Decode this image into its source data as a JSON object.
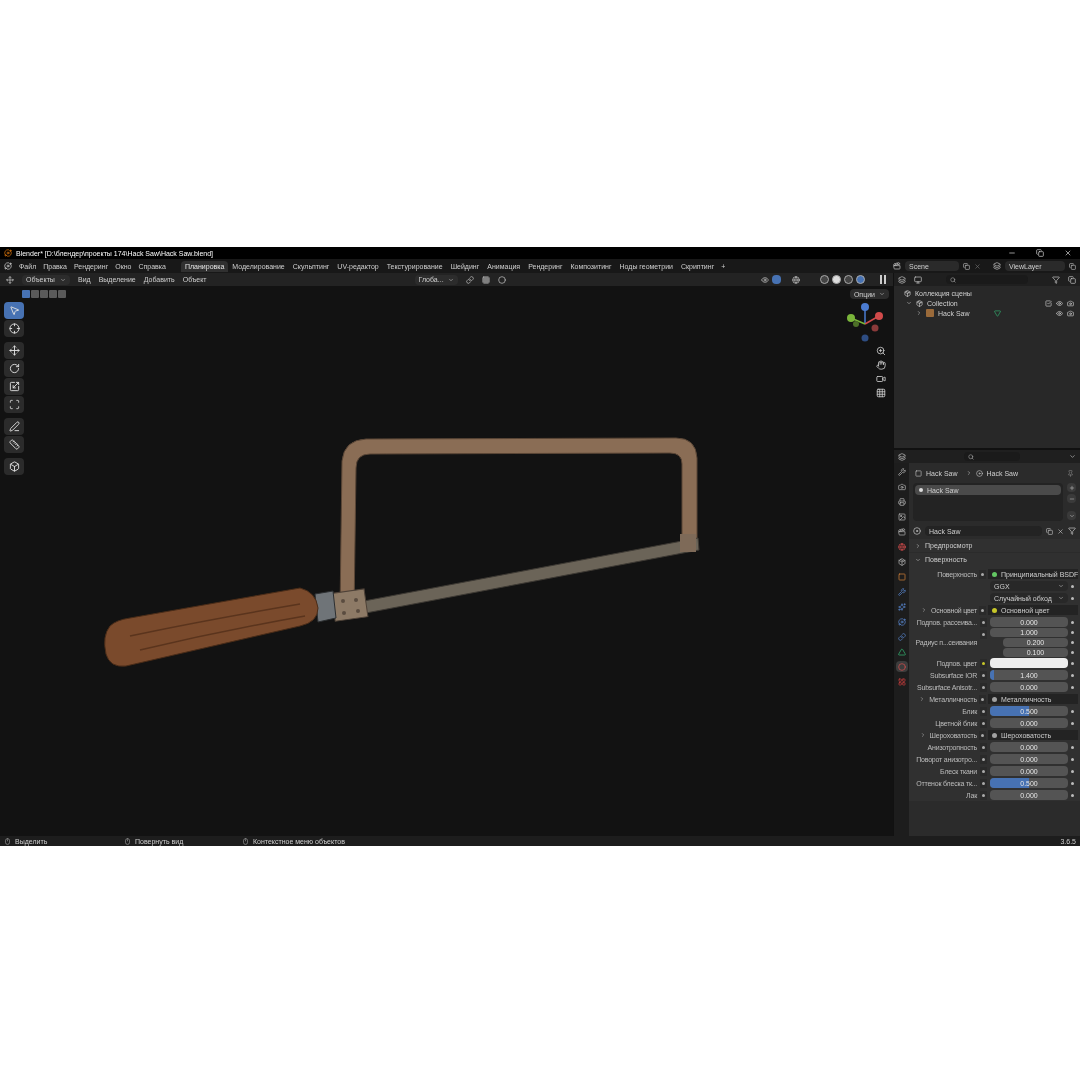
{
  "window": {
    "title": "Blender* [D:\\блендер\\проекты 174\\Hack Saw\\Hack Saw.blend]"
  },
  "menu": [
    "Файл",
    "Правка",
    "Рендеринг",
    "Окно",
    "Справка"
  ],
  "workspaces": [
    {
      "label": "Планировка",
      "selected": true
    },
    {
      "label": "Моделирование",
      "selected": false
    },
    {
      "label": "Скульптинг",
      "selected": false
    },
    {
      "label": "UV-редактор",
      "selected": false
    },
    {
      "label": "Текстурирование",
      "selected": false
    },
    {
      "label": "Шейдинг",
      "selected": false
    },
    {
      "label": "Анимация",
      "selected": false
    },
    {
      "label": "Рендеринг",
      "selected": false
    },
    {
      "label": "Композитинг",
      "selected": false
    },
    {
      "label": "Ноды геометрии",
      "selected": false
    },
    {
      "label": "Скриптинг",
      "selected": false
    }
  ],
  "add_workspace": "+",
  "scene": {
    "name": "Scene"
  },
  "view_layer": {
    "name": "ViewLayer"
  },
  "header": {
    "mode": "Объекты",
    "menus": [
      "Вид",
      "Выделение",
      "Добавить",
      "Объект"
    ],
    "orientation": "Глоба...",
    "options": "Опции"
  },
  "select_modes": [
    {
      "selected": true
    },
    {
      "selected": false
    },
    {
      "selected": false
    },
    {
      "selected": false
    },
    {
      "selected": false
    }
  ],
  "shading": [
    {
      "kind": "wire",
      "selected": false
    },
    {
      "kind": "solid",
      "selected": false
    },
    {
      "kind": "material",
      "selected": false
    },
    {
      "kind": "rendered",
      "selected": true
    }
  ],
  "tools": [
    {
      "kind": "select",
      "selected": true
    },
    {
      "kind": "cursor",
      "selected": false
    },
    {
      "kind": "move",
      "selected": false
    },
    {
      "kind": "rotate",
      "selected": false
    },
    {
      "kind": "scale",
      "selected": false
    },
    {
      "kind": "transform",
      "selected": false
    },
    {
      "kind": "annotate",
      "selected": false
    },
    {
      "kind": "measure",
      "selected": false
    },
    {
      "kind": "add",
      "selected": false
    }
  ],
  "outliner": {
    "root": "Коллекция сцены",
    "items": [
      {
        "label": "Collection",
        "expanded": true,
        "children": [
          {
            "label": "Hack Saw",
            "expanded": false
          }
        ]
      }
    ]
  },
  "properties": {
    "breadcrumb": [
      "Hack Saw",
      "Hack Saw"
    ],
    "tabs": [
      {
        "kind": "tool",
        "selected": false
      },
      {
        "kind": "render",
        "selected": false
      },
      {
        "kind": "output",
        "selected": false
      },
      {
        "kind": "view",
        "selected": false
      },
      {
        "kind": "scene",
        "selected": false
      },
      {
        "kind": "world",
        "selected": false
      },
      {
        "kind": "collection",
        "selected": false
      },
      {
        "kind": "object",
        "selected": false
      },
      {
        "kind": "modifier",
        "selected": false
      },
      {
        "kind": "particles",
        "selected": false
      },
      {
        "kind": "physics",
        "selected": false
      },
      {
        "kind": "constraints",
        "selected": false
      },
      {
        "kind": "data",
        "selected": false
      },
      {
        "kind": "material",
        "selected": true
      },
      {
        "kind": "texture",
        "selected": false
      }
    ],
    "slots": [
      {
        "label": "Hack Saw",
        "selected": true
      }
    ],
    "material": "Hack Saw",
    "panels": [
      {
        "label": "Предпросмотр",
        "expanded": false
      },
      {
        "label": "Поверхность",
        "expanded": true
      }
    ],
    "rows": [
      {
        "kind": "link",
        "label": "Поверхность",
        "value": "Принципиальный BSDF",
        "color": "#63c763",
        "expandable": false
      },
      {
        "kind": "dropdown",
        "value": "GGX"
      },
      {
        "kind": "dropdown",
        "value": "Случайный обход"
      },
      {
        "kind": "link",
        "label": "Основной цвет",
        "value": "Основной цвет",
        "color": "#c7c729",
        "expandable": true
      },
      {
        "kind": "number",
        "label": "Подпов. рассеива...",
        "value": "0.000",
        "level": 0
      },
      {
        "kind": "vector",
        "label": "Радиус п...сеивания",
        "values": [
          "1.000",
          "0.200",
          "0.100"
        ]
      },
      {
        "kind": "color",
        "label": "Подпов. цвет",
        "color": "#eeeeee"
      },
      {
        "kind": "number",
        "label": "Subsurface IOR",
        "value": "1.400",
        "level": 0.05
      },
      {
        "kind": "number",
        "label": "Subsurface Anisotr...",
        "value": "0.000",
        "level": 0
      },
      {
        "kind": "link",
        "label": "Металличность",
        "value": "Металличность",
        "color": "#a1a1a1",
        "expandable": true
      },
      {
        "kind": "number",
        "label": "Блик",
        "value": "0.500",
        "level": 0.5
      },
      {
        "kind": "number",
        "label": "Цветной блик",
        "value": "0.000",
        "level": 0
      },
      {
        "kind": "link",
        "label": "Шероховатость",
        "value": "Шероховатость",
        "color": "#a1a1a1",
        "expandable": true
      },
      {
        "kind": "number",
        "label": "Анизотропность",
        "value": "0.000",
        "level": 0
      },
      {
        "kind": "number",
        "label": "Поворот анизотро...",
        "value": "0.000",
        "level": 0
      },
      {
        "kind": "number",
        "label": "Блеск ткани",
        "value": "0.000",
        "level": 0
      },
      {
        "kind": "number",
        "label": "Оттенок блеска тк...",
        "value": "0.500",
        "level": 0.5
      },
      {
        "kind": "number",
        "label": "Лак",
        "value": "0.000",
        "level": 0
      }
    ]
  },
  "status_bar": {
    "hints": [
      "Выделить",
      "Повернуть вид",
      "Контекстное меню объектов"
    ],
    "version": "3.6.5"
  }
}
